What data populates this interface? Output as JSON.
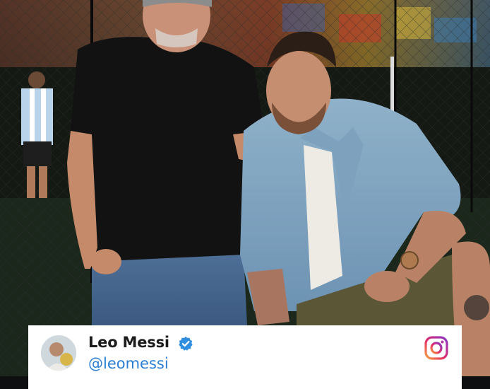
{
  "post": {
    "display_name": "Leo Messi",
    "handle": "@leomessi",
    "verified": true,
    "platform_icon": "instagram-icon",
    "verified_icon": "verified-badge-icon",
    "handle_color": "#2a7fd4",
    "badge_color": "#2f8ee0"
  }
}
